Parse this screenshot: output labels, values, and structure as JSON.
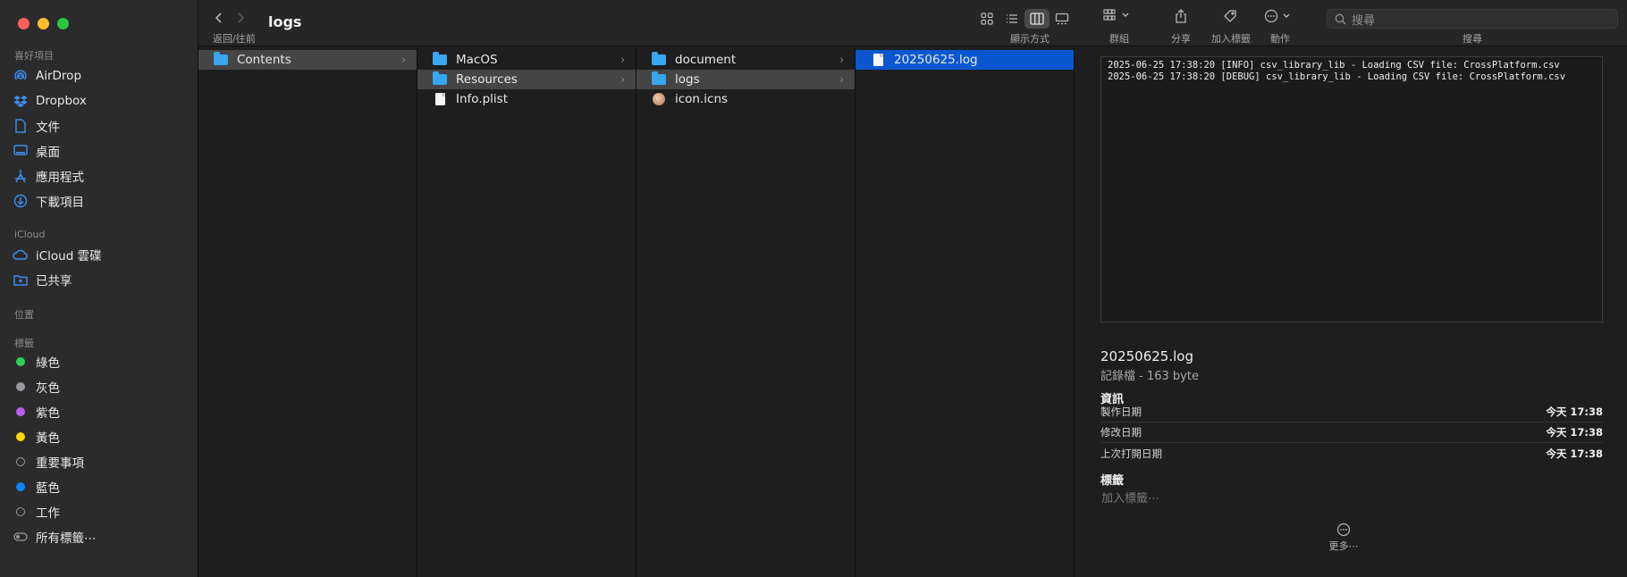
{
  "window": {
    "title": "logs"
  },
  "toolbar": {
    "nav_caption": "返回/往前",
    "view_label": "顯示方式",
    "group_label": "群組",
    "share_label": "分享",
    "add_tag_label": "加入標籤",
    "action_label": "動作",
    "search_label": "搜尋",
    "search_placeholder": "搜尋"
  },
  "sidebar": {
    "favorites_header": "喜好項目",
    "favorites": [
      {
        "label": "AirDrop",
        "icon": "airdrop-icon"
      },
      {
        "label": "Dropbox",
        "icon": "dropbox-icon"
      },
      {
        "label": "文件",
        "icon": "document-icon"
      },
      {
        "label": "桌面",
        "icon": "desktop-icon"
      },
      {
        "label": "應用程式",
        "icon": "applications-icon"
      },
      {
        "label": "下載項目",
        "icon": "downloads-icon"
      }
    ],
    "icloud_header": "iCloud",
    "icloud": [
      {
        "label": "iCloud 雲碟",
        "icon": "icloud-icon"
      },
      {
        "label": "已共享",
        "icon": "shared-folder-icon"
      }
    ],
    "locations_header": "位置",
    "tags_header": "標籤",
    "tags": [
      {
        "label": "綠色",
        "color": "#30d158"
      },
      {
        "label": "灰色",
        "color": "#98989d"
      },
      {
        "label": "紫色",
        "color": "#bf5af2"
      },
      {
        "label": "黃色",
        "color": "#ffd60a"
      },
      {
        "label": "重要事項",
        "color": ""
      },
      {
        "label": "藍色",
        "color": "#0a84ff"
      },
      {
        "label": "工作",
        "color": ""
      },
      {
        "label": "所有標籤⋯",
        "color": ""
      }
    ]
  },
  "columns": [
    [
      {
        "label": "Contents",
        "type": "folder",
        "state": "selected-gray",
        "chevron": true
      }
    ],
    [
      {
        "label": "MacOS",
        "type": "folder",
        "chevron": true
      },
      {
        "label": "Resources",
        "type": "folder",
        "state": "selected-gray",
        "chevron": true
      },
      {
        "label": "Info.plist",
        "type": "file",
        "chevron": false
      }
    ],
    [
      {
        "label": "document",
        "type": "folder",
        "chevron": true
      },
      {
        "label": "logs",
        "type": "folder",
        "state": "selected-gray",
        "chevron": true
      },
      {
        "label": "icon.icns",
        "type": "icns",
        "chevron": false
      }
    ],
    [
      {
        "label": "20250625.log",
        "type": "file",
        "state": "selected-blue",
        "chevron": false
      }
    ]
  ],
  "preview": {
    "log_lines": [
      "2025-06-25 17:38:20 [INFO] csv_library_lib - Loading CSV file: CrossPlatform.csv",
      "2025-06-25 17:38:20 [DEBUG] csv_library_lib - Loading CSV file: CrossPlatform.csv"
    ],
    "file_name": "20250625.log",
    "file_kind": "記錄檔 - 163 byte",
    "info_header": "資訊",
    "info": [
      {
        "key": "製作日期",
        "value": "今天 17:38"
      },
      {
        "key": "修改日期",
        "value": "今天 17:38"
      },
      {
        "key": "上次打開日期",
        "value": "今天 17:38"
      }
    ],
    "tags_header": "標籤",
    "tags_placeholder": "加入標籤⋯",
    "more_label": "更多⋯"
  },
  "colors": {
    "accent_blue": "#0b57d0",
    "folder_blue": "#38a6f0"
  }
}
